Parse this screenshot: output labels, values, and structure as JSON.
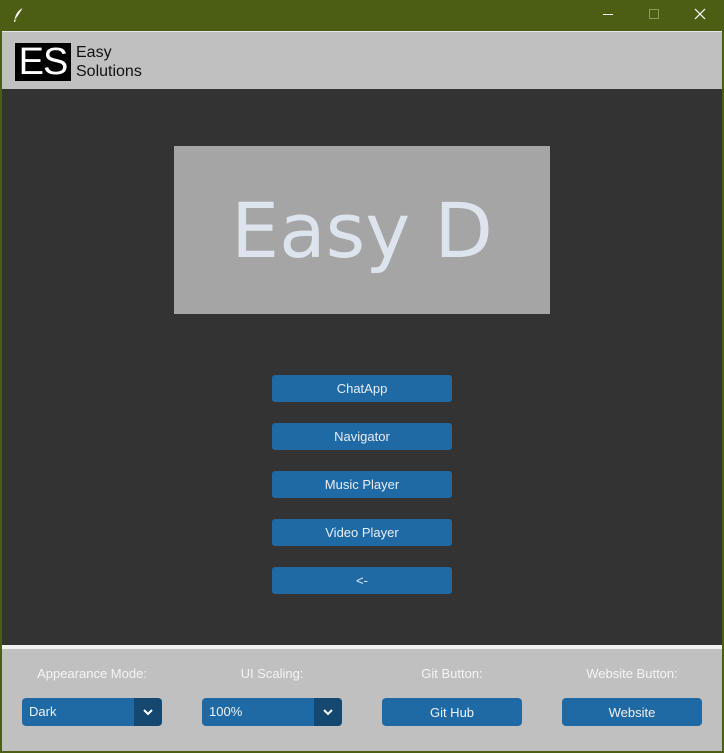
{
  "window": {
    "controls": [
      "minimize-icon",
      "maximize-icon",
      "close-icon"
    ]
  },
  "header": {
    "logo_mark": "ES",
    "logo_line1": "Easy",
    "logo_line2": "Solutions"
  },
  "banner": {
    "title": "Easy D"
  },
  "menu": {
    "buttons": [
      "ChatApp",
      "Navigator",
      "Music Player",
      "Video Player",
      "<-"
    ]
  },
  "footer": {
    "appearance_label": "Appearance Mode:",
    "appearance_value": "Dark",
    "scaling_label": "UI Scaling:",
    "scaling_value": "100%",
    "git_label": "Git Button:",
    "git_button": "Git Hub",
    "website_label": "Website Button:",
    "website_button": "Website"
  },
  "colors": {
    "titlebar": "#4b5e14",
    "header_bg": "#c0c0c0",
    "main_bg": "#333333",
    "banner_bg": "#a5a5a5",
    "button_blue": "#1f6aa5",
    "dropdown_arrow_bg": "#144870"
  }
}
